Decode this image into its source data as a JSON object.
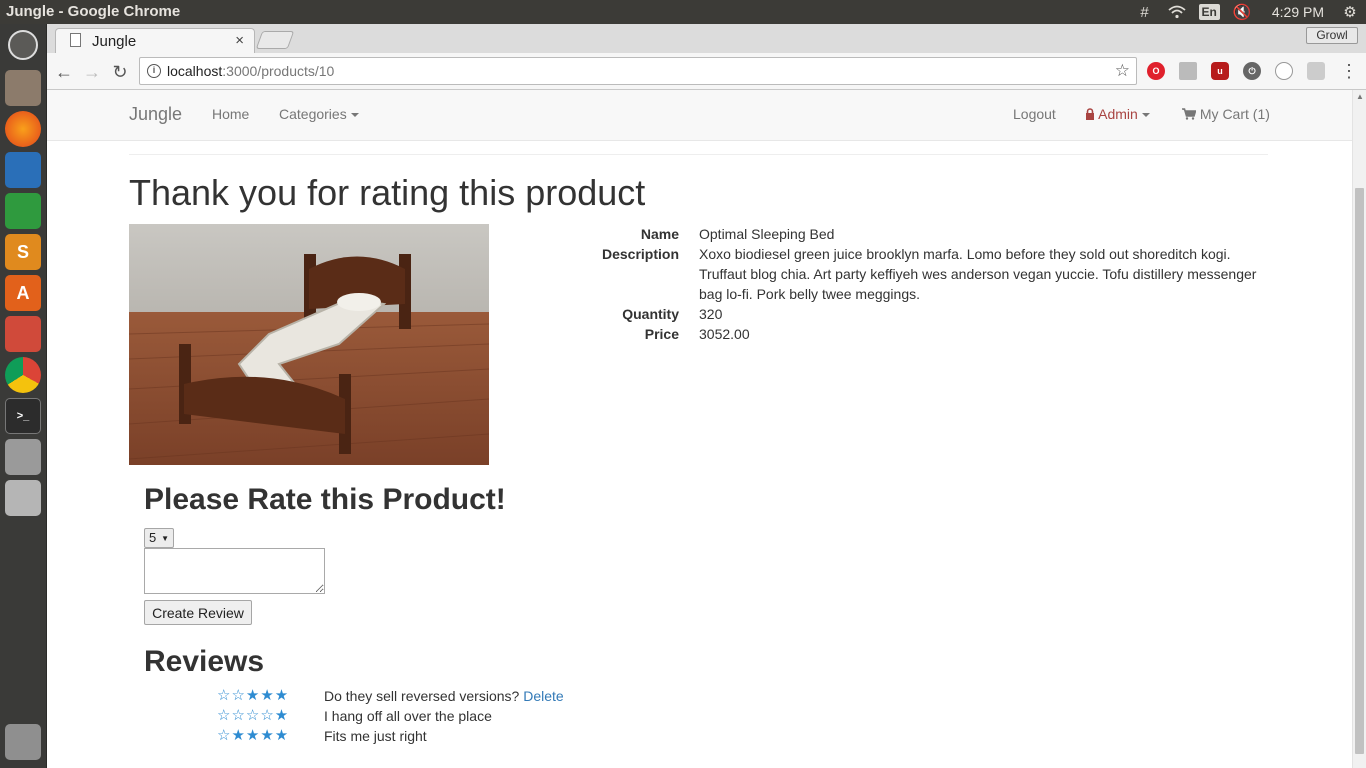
{
  "system": {
    "window_title": "Jungle - Google Chrome",
    "lang": "En",
    "time": "4:29 PM"
  },
  "browser": {
    "tab_title": "Jungle",
    "tab_close": "×",
    "growl_label": "Growl",
    "url_host": "localhost",
    "url_path": ":3000/products/10"
  },
  "nav": {
    "brand": "Jungle",
    "home": "Home",
    "categories": "Categories",
    "logout": "Logout",
    "admin": "Admin",
    "cart": "My Cart (1)"
  },
  "page": {
    "title": "Thank you for rating this product"
  },
  "product": {
    "name_label": "Name",
    "name": "Optimal Sleeping Bed",
    "description_label": "Description",
    "description": "Xoxo biodiesel green juice brooklyn marfa. Lomo before they sold out shoreditch kogi. Truffaut blog chia. Art party keffiyeh wes anderson vegan yuccie. Tofu distillery messenger bag lo-fi. Pork belly twee meggings.",
    "quantity_label": "Quantity",
    "quantity": "320",
    "price_label": "Price",
    "price": "3052.00"
  },
  "rating_form": {
    "title": "Please Rate this Product!",
    "selected_rating": "5",
    "comment": "",
    "submit_label": "Create Review"
  },
  "reviews": {
    "title": "Reviews",
    "items": [
      {
        "stars": "☆☆★★★",
        "rating": 3,
        "text": "Do they sell reversed versions?",
        "delete_label": "Delete"
      },
      {
        "stars": "☆☆☆☆★",
        "rating": 1,
        "text": "I hang off all over the place"
      },
      {
        "stars": "☆★★★★",
        "rating": 4,
        "text": "Fits me just right"
      }
    ]
  },
  "colors": {
    "star": "#2e8bd1",
    "link": "#337ab7",
    "admin": "#a94442"
  }
}
